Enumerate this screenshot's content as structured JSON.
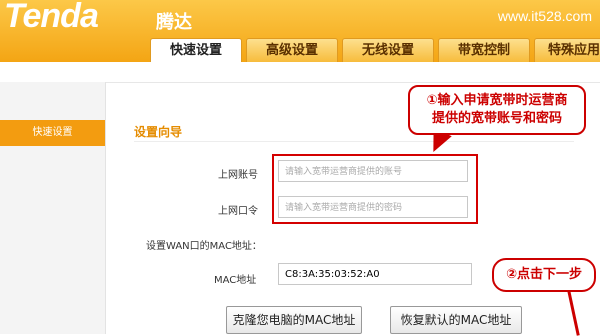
{
  "header": {
    "logo": "Tenda",
    "logo_cn": "腾达",
    "site": "www.it528.com"
  },
  "tabs": [
    {
      "label": "快速设置",
      "active": true
    },
    {
      "label": "高级设置",
      "active": false
    },
    {
      "label": "无线设置",
      "active": false
    },
    {
      "label": "带宽控制",
      "active": false
    },
    {
      "label": "特殊应用",
      "active": false
    }
  ],
  "sidebar": {
    "items": [
      {
        "label": "快速设置",
        "active": true
      }
    ]
  },
  "main": {
    "section_title": "设置向导",
    "account_label": "上网账号",
    "account_placeholder": "请输入宽带运营商提供的账号",
    "password_label": "上网口令",
    "password_placeholder": "请输入宽带运营商提供的密码",
    "wan_mac_label": "设置WAN口的MAC地址：",
    "mac_label": "MAC地址",
    "mac_value": "C8:3A:35:03:52:A0",
    "clone_button": "克隆您电脑的MAC地址",
    "restore_button": "恢复默认的MAC地址"
  },
  "annotations": {
    "callout1_line1": "①输入申请宽带时运营商",
    "callout1_line2": "提供的宽带账号和密码",
    "callout2": "②点击下一步"
  },
  "colors": {
    "brand_orange": "#f4a514",
    "sidebar_active": "#f39c10",
    "section_title": "#e58c00",
    "annotation_red": "#cc0000"
  }
}
